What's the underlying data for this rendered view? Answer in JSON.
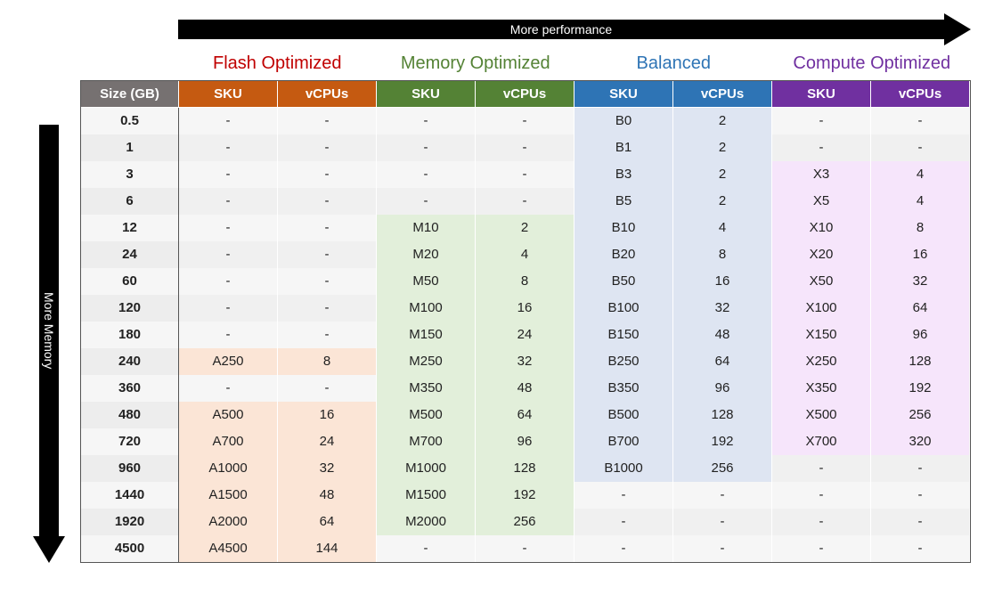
{
  "axes": {
    "top": "More performance",
    "left": "More Memory"
  },
  "tiers": [
    {
      "key": "flash",
      "label": "Flash Optimized",
      "color": "#C00000"
    },
    {
      "key": "mem",
      "label": "Memory Optimized",
      "color": "#548235"
    },
    {
      "key": "bal",
      "label": "Balanced",
      "color": "#2E74B5"
    },
    {
      "key": "comp",
      "label": "Compute Optimized",
      "color": "#7030A0"
    }
  ],
  "headers": {
    "size": "Size (GB)",
    "sku": "SKU",
    "vcpu": "vCPUs"
  },
  "chart_data": {
    "type": "table",
    "size_unit": "GB",
    "rows": [
      {
        "size": "0.5",
        "flash": null,
        "mem": null,
        "bal": {
          "sku": "B0",
          "vcpu": 2
        },
        "comp": null
      },
      {
        "size": "1",
        "flash": null,
        "mem": null,
        "bal": {
          "sku": "B1",
          "vcpu": 2
        },
        "comp": null
      },
      {
        "size": "3",
        "flash": null,
        "mem": null,
        "bal": {
          "sku": "B3",
          "vcpu": 2
        },
        "comp": {
          "sku": "X3",
          "vcpu": 4
        }
      },
      {
        "size": "6",
        "flash": null,
        "mem": null,
        "bal": {
          "sku": "B5",
          "vcpu": 2
        },
        "comp": {
          "sku": "X5",
          "vcpu": 4
        }
      },
      {
        "size": "12",
        "flash": null,
        "mem": {
          "sku": "M10",
          "vcpu": 2
        },
        "bal": {
          "sku": "B10",
          "vcpu": 4
        },
        "comp": {
          "sku": "X10",
          "vcpu": 8
        }
      },
      {
        "size": "24",
        "flash": null,
        "mem": {
          "sku": "M20",
          "vcpu": 4
        },
        "bal": {
          "sku": "B20",
          "vcpu": 8
        },
        "comp": {
          "sku": "X20",
          "vcpu": 16
        }
      },
      {
        "size": "60",
        "flash": null,
        "mem": {
          "sku": "M50",
          "vcpu": 8
        },
        "bal": {
          "sku": "B50",
          "vcpu": 16
        },
        "comp": {
          "sku": "X50",
          "vcpu": 32
        }
      },
      {
        "size": "120",
        "flash": null,
        "mem": {
          "sku": "M100",
          "vcpu": 16
        },
        "bal": {
          "sku": "B100",
          "vcpu": 32
        },
        "comp": {
          "sku": "X100",
          "vcpu": 64
        }
      },
      {
        "size": "180",
        "flash": null,
        "mem": {
          "sku": "M150",
          "vcpu": 24
        },
        "bal": {
          "sku": "B150",
          "vcpu": 48
        },
        "comp": {
          "sku": "X150",
          "vcpu": 96
        }
      },
      {
        "size": "240",
        "flash": {
          "sku": "A250",
          "vcpu": 8
        },
        "mem": {
          "sku": "M250",
          "vcpu": 32
        },
        "bal": {
          "sku": "B250",
          "vcpu": 64
        },
        "comp": {
          "sku": "X250",
          "vcpu": 128
        }
      },
      {
        "size": "360",
        "flash": null,
        "mem": {
          "sku": "M350",
          "vcpu": 48
        },
        "bal": {
          "sku": "B350",
          "vcpu": 96
        },
        "comp": {
          "sku": "X350",
          "vcpu": 192
        }
      },
      {
        "size": "480",
        "flash": {
          "sku": "A500",
          "vcpu": 16
        },
        "mem": {
          "sku": "M500",
          "vcpu": 64
        },
        "bal": {
          "sku": "B500",
          "vcpu": 128
        },
        "comp": {
          "sku": "X500",
          "vcpu": 256
        }
      },
      {
        "size": "720",
        "flash": {
          "sku": "A700",
          "vcpu": 24
        },
        "mem": {
          "sku": "M700",
          "vcpu": 96
        },
        "bal": {
          "sku": "B700",
          "vcpu": 192
        },
        "comp": {
          "sku": "X700",
          "vcpu": 320
        }
      },
      {
        "size": "960",
        "flash": {
          "sku": "A1000",
          "vcpu": 32
        },
        "mem": {
          "sku": "M1000",
          "vcpu": 128
        },
        "bal": {
          "sku": "B1000",
          "vcpu": 256
        },
        "comp": null
      },
      {
        "size": "1440",
        "flash": {
          "sku": "A1500",
          "vcpu": 48
        },
        "mem": {
          "sku": "M1500",
          "vcpu": 192
        },
        "bal": null,
        "comp": null
      },
      {
        "size": "1920",
        "flash": {
          "sku": "A2000",
          "vcpu": 64
        },
        "mem": {
          "sku": "M2000",
          "vcpu": 256
        },
        "bal": null,
        "comp": null
      },
      {
        "size": "4500",
        "flash": {
          "sku": "A4500",
          "vcpu": 144
        },
        "mem": null,
        "bal": null,
        "comp": null
      }
    ]
  }
}
